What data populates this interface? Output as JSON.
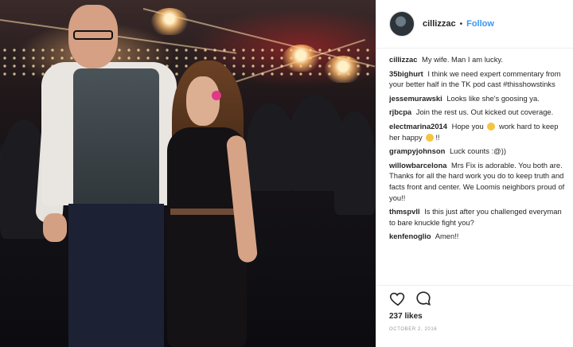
{
  "post": {
    "username": "cillizzac",
    "separator": "•",
    "follow_label": "Follow",
    "likes": "237 likes",
    "date": "OCTOBER 2, 2016",
    "icons": {
      "avatar": "avatar-image",
      "like": "heart-outline-icon",
      "comment": "comment-bubble-icon"
    }
  },
  "comments": [
    {
      "user": "cillizzac",
      "text": "My wife. Man I am lucky."
    },
    {
      "user": "35bighurt",
      "text": "I think we need expert commentary from your better half in the TK pod cast #thisshowstinks"
    },
    {
      "user": "jessemurawski",
      "text": "Looks like she's goosing ya."
    },
    {
      "user": "rjbcpa",
      "text": "Join the rest us. Out kicked out coverage."
    },
    {
      "user": "electmarina2014",
      "text_before": "Hope you",
      "text_middle": "work hard to keep her happy",
      "text_after": "!!"
    },
    {
      "user": "grampyjohnson",
      "text": "Luck counts :@))"
    },
    {
      "user": "willowbarcelona",
      "text": "Mrs Fix is adorable. You both are. Thanks for all the hard work you do to keep truth and facts front and center. We Loomis neighbors proud of you!!"
    },
    {
      "user": "thmspvll",
      "text": "Is this just after you challenged everyman to bare knuckle fight you?"
    },
    {
      "user": "kenfenoglio",
      "text": "Amen!!"
    }
  ],
  "colors": {
    "accent": "#3897f0",
    "text": "#262626",
    "muted": "#999999"
  }
}
